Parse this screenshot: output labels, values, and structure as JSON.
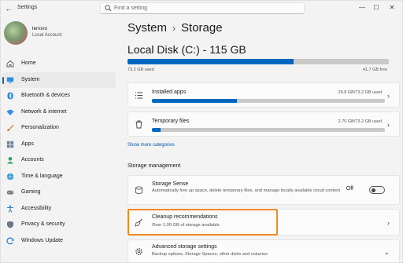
{
  "app": {
    "title": "Settings"
  },
  "search": {
    "placeholder": "Find a setting"
  },
  "window_controls": {
    "minimize": "—",
    "maximize": "☐",
    "close": "✕"
  },
  "profile": {
    "name": "lenovo",
    "account_type": "Local Account"
  },
  "sidebar": {
    "items": [
      {
        "label": "Home",
        "icon": "home-icon"
      },
      {
        "label": "System",
        "icon": "system-icon",
        "active": true
      },
      {
        "label": "Bluetooth & devices",
        "icon": "bluetooth-icon"
      },
      {
        "label": "Network & internet",
        "icon": "wifi-icon"
      },
      {
        "label": "Personalization",
        "icon": "brush-icon"
      },
      {
        "label": "Apps",
        "icon": "apps-icon"
      },
      {
        "label": "Accounts",
        "icon": "account-icon"
      },
      {
        "label": "Time & language",
        "icon": "globe-icon"
      },
      {
        "label": "Gaming",
        "icon": "gamepad-icon"
      },
      {
        "label": "Accessibility",
        "icon": "accessibility-icon"
      },
      {
        "label": "Privacy & security",
        "icon": "shield-icon"
      },
      {
        "label": "Windows Update",
        "icon": "update-icon"
      }
    ]
  },
  "breadcrumb": {
    "parent": "System",
    "separator": "›",
    "current": "Storage"
  },
  "disk": {
    "title": "Local Disk (C:) - 115 GB",
    "used_label": "73.2 GB used",
    "available_label": "41.7 GB free",
    "used_fraction": 0.637
  },
  "categories": [
    {
      "title": "Installed apps",
      "value": "26.8 GB/73.2 GB used",
      "fraction": 0.366,
      "icon": "list-icon"
    },
    {
      "title": "Temporary files",
      "value": "2.70 GB/73.2 GB used",
      "fraction": 0.037,
      "icon": "trash-icon"
    }
  ],
  "show_more": "Show more categories",
  "storage_management": {
    "section_title": "Storage management",
    "storage_sense": {
      "title": "Storage Sense",
      "description": "Automatically free up space, delete temporary files, and manage locally available cloud content",
      "toggle_label": "Off",
      "enabled": false
    },
    "cleanup": {
      "title": "Cleanup recommendations",
      "description": "Over 1.00 GB of storage available."
    },
    "advanced": {
      "title": "Advanced storage settings",
      "description": "Backup options, Storage Spaces, other disks and volumes"
    }
  },
  "colors": {
    "accent": "#0067c0",
    "highlight": "#f08a24"
  }
}
